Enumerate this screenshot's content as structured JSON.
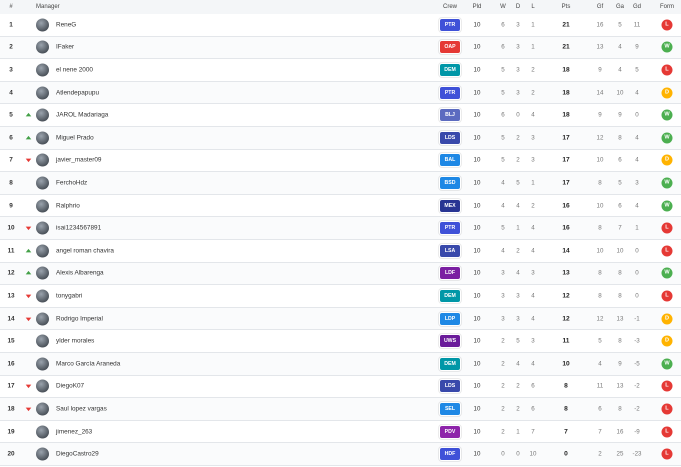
{
  "header": {
    "pos": "#",
    "manager": "Manager",
    "crew": "Crew",
    "pld": "Pld",
    "w": "W",
    "d": "D",
    "l": "L",
    "pts": "Pts",
    "gf": "Gf",
    "ga": "Ga",
    "gd": "Gd",
    "form": "Form"
  },
  "colors": {
    "win": "#4caf50",
    "draw": "#ffb300",
    "loss": "#e53935",
    "up": "#43a047",
    "down": "#e53935"
  },
  "rows": [
    {
      "pos": "1",
      "trend": "none",
      "manager": "ReneG",
      "crew": "PTR",
      "crew_color": "#3f51d8",
      "pld": "10",
      "w": "6",
      "d": "3",
      "l": "1",
      "pts": "21",
      "gf": "16",
      "ga": "5",
      "gd": "11",
      "form": "L"
    },
    {
      "pos": "2",
      "trend": "none",
      "manager": "IFaker",
      "crew": "OAP",
      "crew_color": "#e53935",
      "pld": "10",
      "w": "6",
      "d": "3",
      "l": "1",
      "pts": "21",
      "gf": "13",
      "ga": "4",
      "gd": "9",
      "form": "W"
    },
    {
      "pos": "3",
      "trend": "none",
      "manager": "el nene 2000",
      "crew": "DEM",
      "crew_color": "#0097a7",
      "pld": "10",
      "w": "5",
      "d": "3",
      "l": "2",
      "pts": "18",
      "gf": "9",
      "ga": "4",
      "gd": "5",
      "form": "L"
    },
    {
      "pos": "4",
      "trend": "none",
      "manager": "Atlendepapupu",
      "crew": "PTR",
      "crew_color": "#3f51d8",
      "pld": "10",
      "w": "5",
      "d": "3",
      "l": "2",
      "pts": "18",
      "gf": "14",
      "ga": "10",
      "gd": "4",
      "form": "D"
    },
    {
      "pos": "5",
      "trend": "up",
      "manager": "JAROL Madariaga",
      "crew": "BLJ",
      "crew_color": "#5c6bc0",
      "pld": "10",
      "w": "6",
      "d": "0",
      "l": "4",
      "pts": "18",
      "gf": "9",
      "ga": "9",
      "gd": "0",
      "form": "W"
    },
    {
      "pos": "6",
      "trend": "up",
      "manager": "Miguel Prado",
      "crew": "LDS",
      "crew_color": "#3949ab",
      "pld": "10",
      "w": "5",
      "d": "2",
      "l": "3",
      "pts": "17",
      "gf": "12",
      "ga": "8",
      "gd": "4",
      "form": "W"
    },
    {
      "pos": "7",
      "trend": "down",
      "manager": "javier_master09",
      "crew": "BAL",
      "crew_color": "#1e88e5",
      "pld": "10",
      "w": "5",
      "d": "2",
      "l": "3",
      "pts": "17",
      "gf": "10",
      "ga": "6",
      "gd": "4",
      "form": "D"
    },
    {
      "pos": "8",
      "trend": "none",
      "manager": "FerchoHdz",
      "crew": "BSD",
      "crew_color": "#1e88e5",
      "pld": "10",
      "w": "4",
      "d": "5",
      "l": "1",
      "pts": "17",
      "gf": "8",
      "ga": "5",
      "gd": "3",
      "form": "W"
    },
    {
      "pos": "9",
      "trend": "none",
      "manager": "Ralphrio",
      "crew": "MEX",
      "crew_color": "#283593",
      "pld": "10",
      "w": "4",
      "d": "4",
      "l": "2",
      "pts": "16",
      "gf": "10",
      "ga": "6",
      "gd": "4",
      "form": "W"
    },
    {
      "pos": "10",
      "trend": "down",
      "manager": "isai1234567891",
      "crew": "PTR",
      "crew_color": "#3f51d8",
      "pld": "10",
      "w": "5",
      "d": "1",
      "l": "4",
      "pts": "16",
      "gf": "8",
      "ga": "7",
      "gd": "1",
      "form": "L"
    },
    {
      "pos": "11",
      "trend": "up",
      "manager": "angel roman chavira",
      "crew": "LSA",
      "crew_color": "#3949ab",
      "pld": "10",
      "w": "4",
      "d": "2",
      "l": "4",
      "pts": "14",
      "gf": "10",
      "ga": "10",
      "gd": "0",
      "form": "L"
    },
    {
      "pos": "12",
      "trend": "up",
      "manager": "Alexis Albarenga",
      "crew": "LDF",
      "crew_color": "#7b1fa2",
      "pld": "10",
      "w": "3",
      "d": "4",
      "l": "3",
      "pts": "13",
      "gf": "8",
      "ga": "8",
      "gd": "0",
      "form": "W"
    },
    {
      "pos": "13",
      "trend": "down",
      "manager": "tonygabri",
      "crew": "DEM",
      "crew_color": "#0097a7",
      "pld": "10",
      "w": "3",
      "d": "3",
      "l": "4",
      "pts": "12",
      "gf": "8",
      "ga": "8",
      "gd": "0",
      "form": "L"
    },
    {
      "pos": "14",
      "trend": "down",
      "manager": "Rodrigo Imperial",
      "crew": "LDP",
      "crew_color": "#1e88e5",
      "pld": "10",
      "w": "3",
      "d": "3",
      "l": "4",
      "pts": "12",
      "gf": "12",
      "ga": "13",
      "gd": "-1",
      "form": "D"
    },
    {
      "pos": "15",
      "trend": "none",
      "manager": "ylder morales",
      "crew": "UWS",
      "crew_color": "#6a1b9a",
      "pld": "10",
      "w": "2",
      "d": "5",
      "l": "3",
      "pts": "11",
      "gf": "5",
      "ga": "8",
      "gd": "-3",
      "form": "D"
    },
    {
      "pos": "16",
      "trend": "none",
      "manager": "Marco García Araneda",
      "crew": "DEM",
      "crew_color": "#0097a7",
      "pld": "10",
      "w": "2",
      "d": "4",
      "l": "4",
      "pts": "10",
      "gf": "4",
      "ga": "9",
      "gd": "-5",
      "form": "W"
    },
    {
      "pos": "17",
      "trend": "down",
      "manager": "DiegoK07",
      "crew": "LDS",
      "crew_color": "#3949ab",
      "pld": "10",
      "w": "2",
      "d": "2",
      "l": "6",
      "pts": "8",
      "gf": "11",
      "ga": "13",
      "gd": "-2",
      "form": "L"
    },
    {
      "pos": "18",
      "trend": "down",
      "manager": "Saul lopez vargas",
      "crew": "SEL",
      "crew_color": "#1e88e5",
      "pld": "10",
      "w": "2",
      "d": "2",
      "l": "6",
      "pts": "8",
      "gf": "6",
      "ga": "8",
      "gd": "-2",
      "form": "L"
    },
    {
      "pos": "19",
      "trend": "none",
      "manager": "jimenez_263",
      "crew": "PDV",
      "crew_color": "#8e24aa",
      "pld": "10",
      "w": "2",
      "d": "1",
      "l": "7",
      "pts": "7",
      "gf": "7",
      "ga": "16",
      "gd": "-9",
      "form": "L"
    },
    {
      "pos": "20",
      "trend": "none",
      "manager": "DiegoCastro29",
      "crew": "HDF",
      "crew_color": "#3f51d8",
      "pld": "10",
      "w": "0",
      "d": "0",
      "l": "10",
      "pts": "0",
      "gf": "2",
      "ga": "25",
      "gd": "-23",
      "form": "L"
    }
  ]
}
